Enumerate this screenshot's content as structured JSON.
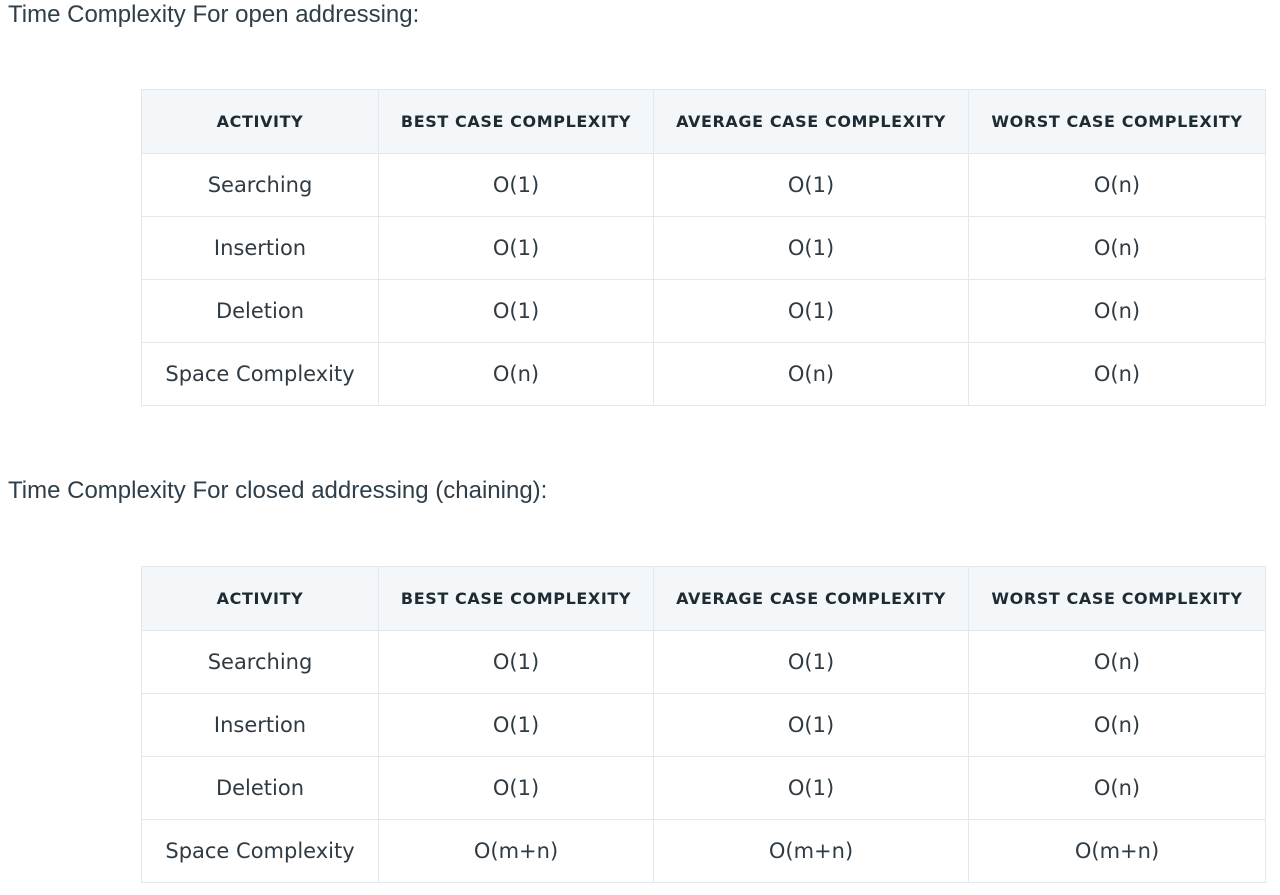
{
  "sections": [
    {
      "heading": "Time Complexity For open addressing:",
      "headers": [
        "ACTIVITY",
        "BEST CASE COMPLEXITY",
        "AVERAGE CASE COMPLEXITY",
        "WORST CASE COMPLEXITY"
      ],
      "rows": [
        [
          "Searching",
          "O(1)",
          "O(1)",
          "O(n)"
        ],
        [
          "Insertion",
          "O(1)",
          "O(1)",
          "O(n)"
        ],
        [
          "Deletion",
          "O(1)",
          "O(1)",
          "O(n)"
        ],
        [
          "Space Complexity",
          "O(n)",
          "O(n)",
          "O(n)"
        ]
      ]
    },
    {
      "heading": "Time Complexity For closed addressing (chaining):",
      "headers": [
        "ACTIVITY",
        "BEST CASE COMPLEXITY",
        "AVERAGE CASE COMPLEXITY",
        "WORST CASE COMPLEXITY"
      ],
      "rows": [
        [
          "Searching",
          "O(1)",
          "O(1)",
          "O(n)"
        ],
        [
          "Insertion",
          "O(1)",
          "O(1)",
          "O(n)"
        ],
        [
          "Deletion",
          "O(1)",
          "O(1)",
          "O(n)"
        ],
        [
          "Space Complexity",
          "O(m+n)",
          "O(m+n)",
          "O(m+n)"
        ]
      ]
    }
  ]
}
